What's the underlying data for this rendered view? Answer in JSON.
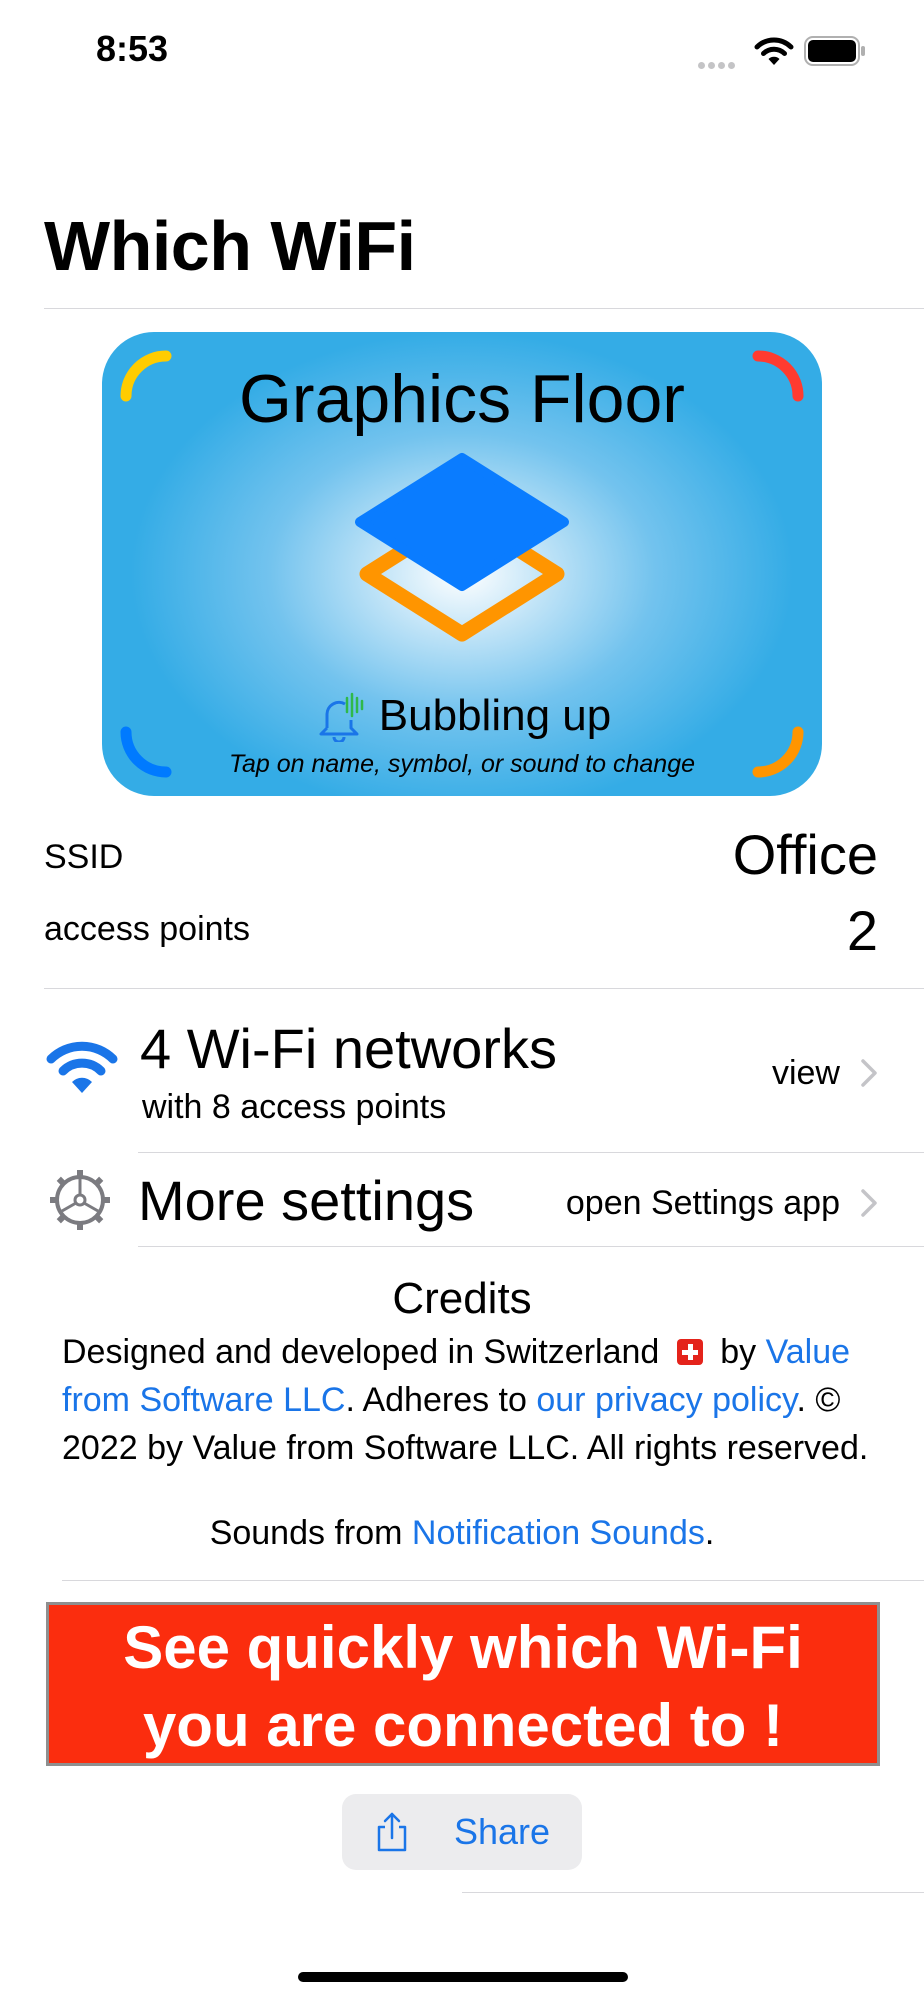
{
  "status_bar": {
    "time": "8:53",
    "signal_icon": "signal-dots-icon",
    "wifi_icon": "wifi-icon",
    "battery_icon": "battery-icon"
  },
  "page": {
    "title": "Which WiFi"
  },
  "card": {
    "name": "Graphics Floor",
    "symbol": "square-stack-icon",
    "sound": "Bubbling up",
    "sound_icon": "bell-icon",
    "hint": "Tap on name, symbol, or sound to change",
    "colors": {
      "top_left": "#ffcc00",
      "top_right": "#ff3b30",
      "bottom_left": "#007aff",
      "bottom_right": "#ff9500",
      "symbol_top": "#0a7cff",
      "symbol_bottom": "#ff9500"
    }
  },
  "info": {
    "ssid_label": "SSID",
    "ssid_value": "Office",
    "ap_label": "access points",
    "ap_value": "2"
  },
  "networks": {
    "title": "4 Wi-Fi networks",
    "subtitle": "with 8 access points",
    "action": "view"
  },
  "more_settings": {
    "title": "More settings",
    "action": "open Settings app"
  },
  "credits": {
    "title": "Credits",
    "line_prefix": "Designed and developed in Switzerland",
    "line_by": "by",
    "company_link": "Value from Software LLC",
    "adheres": ". Adheres to ",
    "privacy_link": "our privacy policy",
    "copyright": ". © 2022 by Value from Software LLC. All rights reserved.",
    "sounds_prefix": "Sounds from ",
    "sounds_link": "Notification Sounds",
    "sounds_suffix": "."
  },
  "banner": {
    "line1": "See quickly which Wi-Fi",
    "line2": "you are connected to !"
  },
  "share": {
    "label": "Share"
  },
  "colors": {
    "accent": "#1a75e8",
    "banner": "#fb2d0e"
  }
}
